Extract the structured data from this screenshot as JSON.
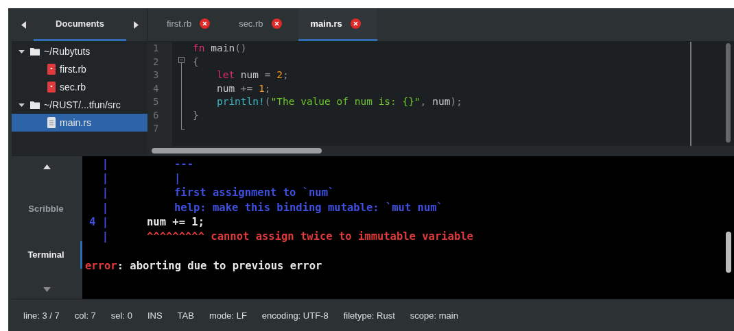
{
  "sidebar": {
    "tabs": [
      {
        "label": "Documents",
        "selected": true
      }
    ],
    "tree": [
      {
        "label": "~/Rubytuts",
        "kind": "folder",
        "expanded": true,
        "selected": false,
        "children": [
          {
            "label": "first.rb",
            "kind": "ruby",
            "selected": false
          },
          {
            "label": "sec.rb",
            "kind": "ruby",
            "selected": false
          }
        ]
      },
      {
        "label": "~/RUST/...tfun/src",
        "kind": "folder",
        "expanded": true,
        "selected": false,
        "children": [
          {
            "label": "main.rs",
            "kind": "text",
            "selected": true
          }
        ]
      }
    ]
  },
  "tabs": [
    {
      "label": "first.rb",
      "selected": false
    },
    {
      "label": "sec.rb",
      "selected": false
    },
    {
      "label": "main.rs",
      "selected": true
    }
  ],
  "editor": {
    "lines": [
      {
        "number": "1",
        "tokens": [
          {
            "text": "fn",
            "kind": "keyword"
          },
          {
            "text": " main",
            "kind": "ident"
          },
          {
            "text": "()",
            "kind": "punct"
          }
        ]
      },
      {
        "number": "2",
        "tokens": [
          {
            "text": "{",
            "kind": "punct"
          }
        ]
      },
      {
        "number": "3",
        "tokens": [
          {
            "text": "    let",
            "kind": "keyword"
          },
          {
            "text": " num ",
            "kind": "ident"
          },
          {
            "text": "=",
            "kind": "punct"
          },
          {
            "text": " 2",
            "kind": "number"
          },
          {
            "text": ";",
            "kind": "punct"
          }
        ]
      },
      {
        "number": "4",
        "tokens": [
          {
            "text": "    num ",
            "kind": "ident"
          },
          {
            "text": "+=",
            "kind": "punct"
          },
          {
            "text": " 1",
            "kind": "number"
          },
          {
            "text": ";",
            "kind": "punct"
          }
        ]
      },
      {
        "number": "5",
        "tokens": [
          {
            "text": "    println!",
            "kind": "macro"
          },
          {
            "text": "(",
            "kind": "punct"
          },
          {
            "text": "\"The value of num is: {}\"",
            "kind": "string"
          },
          {
            "text": ", ",
            "kind": "punct"
          },
          {
            "text": "num",
            "kind": "ident"
          },
          {
            "text": ");",
            "kind": "punct"
          }
        ]
      },
      {
        "number": "6",
        "tokens": [
          {
            "text": "}",
            "kind": "punct"
          }
        ]
      },
      {
        "number": "7"
      }
    ]
  },
  "bottom_tabs": [
    {
      "label": "Scribble",
      "selected": false
    },
    {
      "label": "Terminal",
      "selected": true
    }
  ],
  "terminal": {
    "lines": [
      {
        "gutter": "|",
        "kind": "note",
        "segments": [
          {
            "text": "---",
            "kind": "note"
          }
        ]
      },
      {
        "gutter": "|",
        "kind": "note",
        "segments": [
          {
            "text": "|",
            "kind": "note"
          }
        ]
      },
      {
        "gutter": "|",
        "kind": "note",
        "segments": [
          {
            "text": "first assignment to `num`",
            "kind": "note"
          }
        ]
      },
      {
        "gutter": "|",
        "kind": "note",
        "segments": [
          {
            "text": "help: make this binding mutable: `mut num`",
            "kind": "note"
          }
        ]
      },
      {
        "gutter": "4 |",
        "kind": "source",
        "segments": [
          {
            "text": "num += 1;",
            "kind": "plain"
          }
        ]
      },
      {
        "gutter": "|",
        "kind": "source",
        "segments": [
          {
            "text": "^^^^^^^^^",
            "kind": "error"
          },
          {
            "text": " cannot assign twice to immutable variable",
            "kind": "error"
          }
        ]
      },
      {
        "kind": "blank"
      },
      {
        "kind": "message",
        "segments": [
          {
            "text": "error",
            "kind": "error"
          },
          {
            "text": ": aborting due to previous error",
            "kind": "plain"
          }
        ]
      }
    ]
  },
  "status_bar": [
    "line: 3 / 7",
    "col: 7",
    "sel: 0",
    "INS",
    "TAB",
    "mode: LF",
    "encoding: UTF-8",
    "filetype: Rust",
    "scope: main"
  ]
}
